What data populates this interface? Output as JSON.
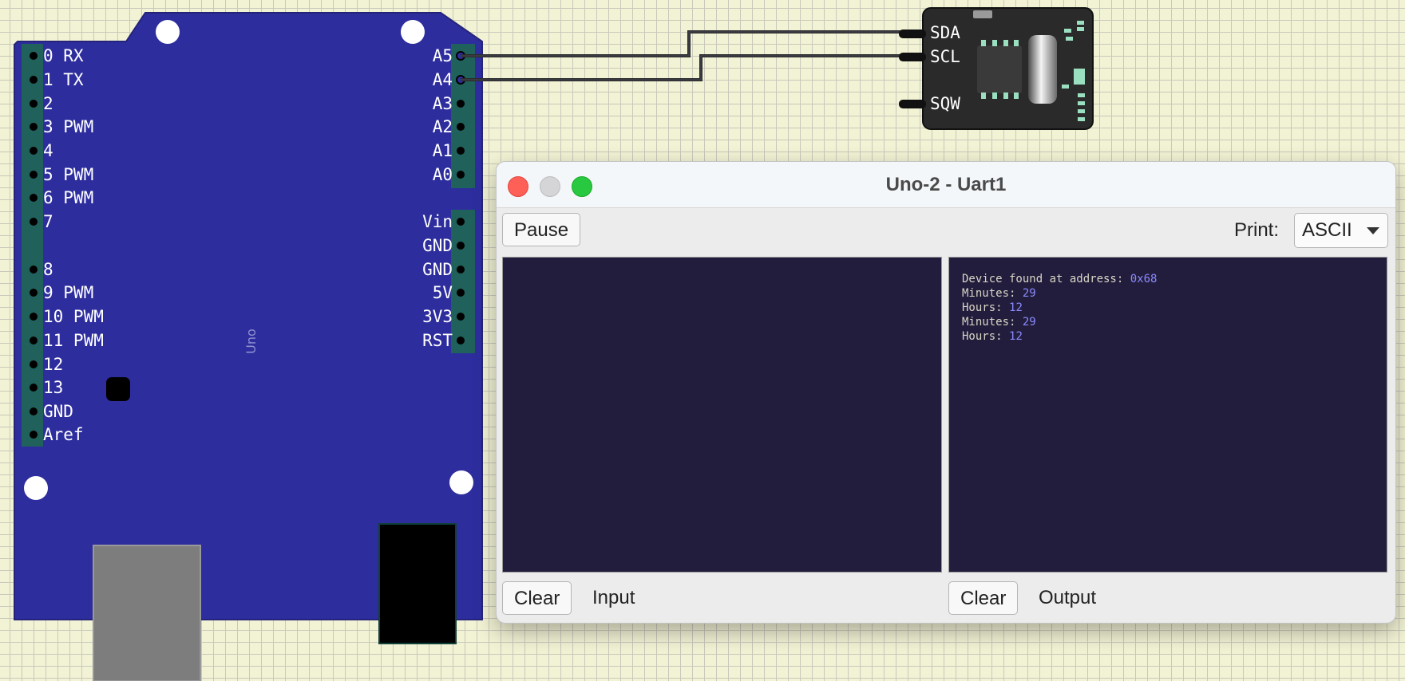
{
  "arduino": {
    "board_label": "Uno",
    "left_pins": [
      "0 RX",
      "1 TX",
      "2",
      "3 PWM",
      "4",
      "5 PWM",
      "6 PWM",
      "7",
      "8",
      "9 PWM",
      "10 PWM",
      "11 PWM",
      "12",
      "13",
      "GND",
      "Aref"
    ],
    "right_pins": [
      "A5",
      "A4",
      "A3",
      "A2",
      "A1",
      "A0",
      "Vin",
      "GND",
      "GND",
      "5V",
      "3V3",
      "RST"
    ]
  },
  "rtc_module": {
    "pins": [
      "SDA",
      "SCL",
      "SQW"
    ]
  },
  "serial_monitor": {
    "title": "Uno-2 - Uart1",
    "pause_label": "Pause",
    "print_label": "Print:",
    "print_mode": "ASCII",
    "input_clear_label": "Clear",
    "input_label": "Input",
    "output_clear_label": "Clear",
    "output_label": "Output",
    "output_lines": [
      {
        "key": "Device found at address: ",
        "value": "0x68"
      },
      {
        "key": "Minutes: ",
        "value": "29"
      },
      {
        "key": "Hours: ",
        "value": "12"
      },
      {
        "key": "Minutes: ",
        "value": "29"
      },
      {
        "key": "Hours: ",
        "value": "12"
      }
    ]
  },
  "colors": {
    "board": "#2d2d9e",
    "console_bg": "#231d3d",
    "console_value": "#8a8aff",
    "wire": "#2b2b2b"
  }
}
